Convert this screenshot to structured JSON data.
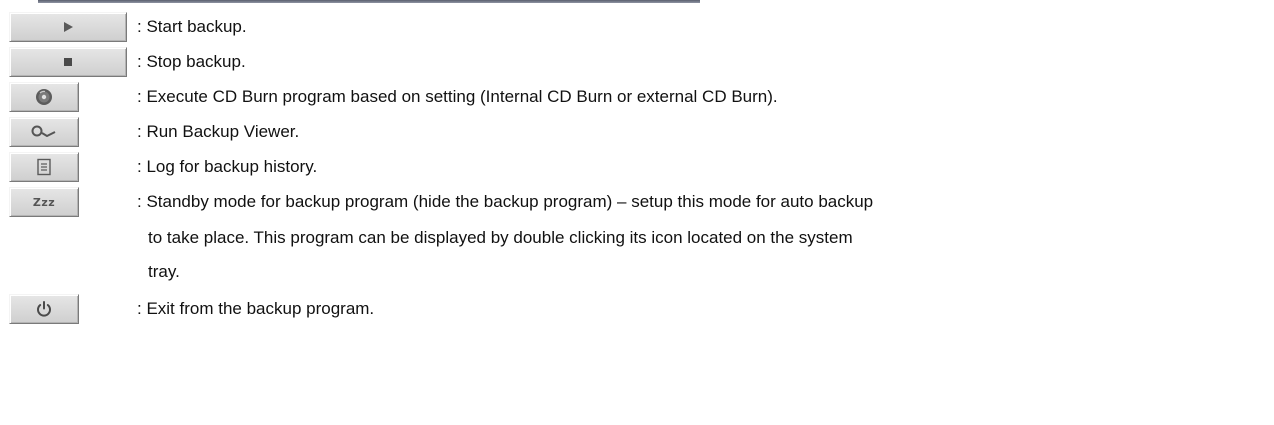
{
  "items": [
    {
      "icon": "play-icon",
      "description": ": Start backup."
    },
    {
      "icon": "stop-icon",
      "description": ": Stop backup."
    },
    {
      "icon": "cd-burn-icon",
      "description": ": Execute CD Burn program based on setting (Internal CD Burn or external CD Burn)."
    },
    {
      "icon": "backup-viewer-icon",
      "description": ": Run Backup Viewer."
    },
    {
      "icon": "log-icon",
      "description": ": Log for backup history."
    },
    {
      "icon": "standby-icon",
      "button_label": "Zzz",
      "description": ": Standby mode for backup program (hide the backup program) – setup this mode for auto backup",
      "continuation": [
        "to take place. This program can be displayed by double clicking its icon located on the system",
        "tray."
      ]
    },
    {
      "icon": "power-icon",
      "description": ": Exit from the backup program."
    }
  ]
}
